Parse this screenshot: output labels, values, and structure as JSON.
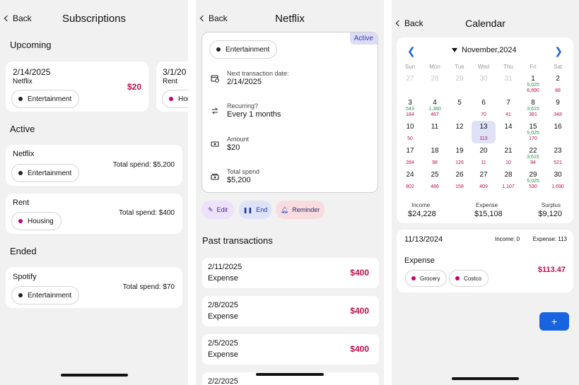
{
  "subscriptions": {
    "back": "Back",
    "title": "Subscriptions",
    "upcoming_heading": "Upcoming",
    "upcoming": [
      {
        "date": "2/14/2025",
        "name": "Netflix",
        "category": "Entertainment",
        "amount": "$20"
      },
      {
        "date": "3/1/20",
        "name": "Rent",
        "category": "Hou"
      }
    ],
    "active_heading": "Active",
    "active": [
      {
        "name": "Netflix",
        "category": "Entertainment",
        "total": "Total spend: $5,200"
      },
      {
        "name": "Rent",
        "category": "Housing",
        "total": "Total spend: $400"
      }
    ],
    "ended_heading": "Ended",
    "ended": [
      {
        "name": "Spotify",
        "category": "Entertainment",
        "total": "Total spend: $70"
      }
    ]
  },
  "netflix": {
    "back": "Back",
    "title": "Netflix",
    "status": "Active",
    "category": "Entertainment",
    "next_label": "Next transaction date:",
    "next_value": "2/14/2025",
    "recurring_label": "Recurring?",
    "recurring_value": "Every 1 months",
    "amount_label": "Amount",
    "amount_value": "$20",
    "total_label": "Total spend",
    "total_value": "$5,200",
    "buttons": {
      "edit": "Edit",
      "end": "End",
      "reminder": "Reminder"
    },
    "past_heading": "Past transactions",
    "transactions": [
      {
        "date": "2/11/2025",
        "type": "Expense",
        "amount": "$400"
      },
      {
        "date": "2/8/2025",
        "type": "Expense",
        "amount": "$400"
      },
      {
        "date": "2/5/2025",
        "type": "Expense",
        "amount": "$400"
      },
      {
        "date": "2/2/2025"
      }
    ]
  },
  "calendar": {
    "back": "Back",
    "title": "Calendar",
    "month": "November,2024",
    "weekdays": [
      "Sun",
      "Mon",
      "Tue",
      "Wed",
      "Thu",
      "Fri",
      "Sat"
    ],
    "weeks": [
      [
        {
          "d": "27",
          "o": true
        },
        {
          "d": "28",
          "o": true
        },
        {
          "d": "29",
          "o": true
        },
        {
          "d": "30",
          "o": true
        },
        {
          "d": "31",
          "o": true
        },
        {
          "d": "1",
          "i": "5,025",
          "e": "6,890"
        },
        {
          "d": "2",
          "e": "88"
        }
      ],
      [
        {
          "d": "3",
          "i": "543",
          "e": "184"
        },
        {
          "d": "4",
          "i": "1,380",
          "e": "467"
        },
        {
          "d": "5"
        },
        {
          "d": "6",
          "e": "70"
        },
        {
          "d": "7",
          "e": "41"
        },
        {
          "d": "8",
          "i": "3,615",
          "e": "381"
        },
        {
          "d": "9",
          "e": "348"
        }
      ],
      [
        {
          "d": "10",
          "e": "50"
        },
        {
          "d": "11"
        },
        {
          "d": "12"
        },
        {
          "d": "13",
          "e": "113",
          "sel": true
        },
        {
          "d": "14"
        },
        {
          "d": "15",
          "i": "5,025",
          "e": "170"
        },
        {
          "d": "16"
        }
      ],
      [
        {
          "d": "17",
          "e": "284"
        },
        {
          "d": "18",
          "e": "98"
        },
        {
          "d": "19",
          "e": "126"
        },
        {
          "d": "20",
          "e": "11"
        },
        {
          "d": "21",
          "e": "10"
        },
        {
          "d": "22",
          "i": "3,615",
          "e": "84"
        },
        {
          "d": "23",
          "e": "521"
        }
      ],
      [
        {
          "d": "24",
          "e": "802"
        },
        {
          "d": "25",
          "e": "486"
        },
        {
          "d": "26",
          "e": "158"
        },
        {
          "d": "27",
          "e": "409"
        },
        {
          "d": "28",
          "e": "1,107"
        },
        {
          "d": "29",
          "i": "5,025",
          "e": "530"
        },
        {
          "d": "30",
          "e": "1,690"
        }
      ]
    ],
    "summary": {
      "income_label": "Income",
      "income": "$24,228",
      "expense_label": "Expense",
      "expense": "$15,108",
      "surplus_label": "Surplus",
      "surplus": "$9,120"
    },
    "day": {
      "date": "11/13/2024",
      "income": "Income: 0",
      "expense": "Expense: 113",
      "type": "Expense",
      "tags": [
        "Grocery",
        "Costco"
      ],
      "amount": "$113.47"
    },
    "fab": "+"
  },
  "colors": {
    "accent": "#1763e0",
    "amount": "#c20e4b",
    "income": "#1d9a44"
  }
}
